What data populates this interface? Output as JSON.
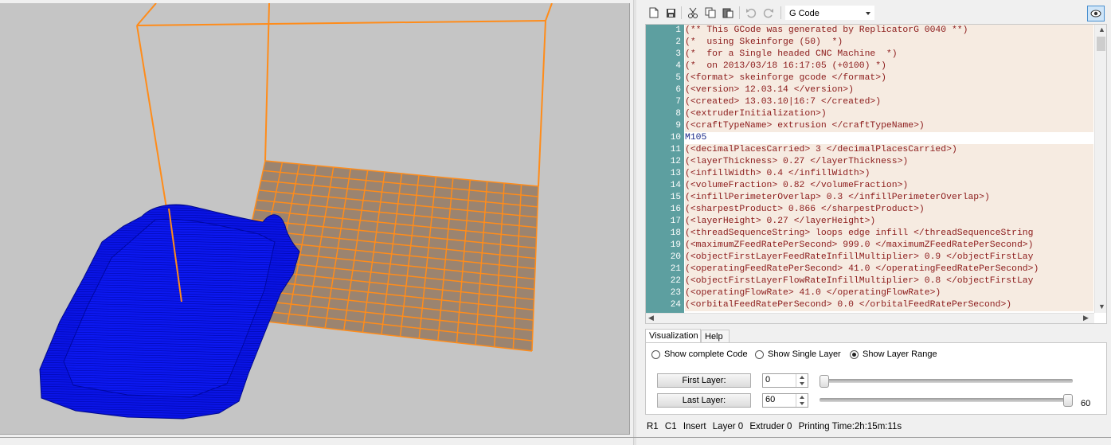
{
  "toolbar": {
    "buttons": [
      "new-file-icon",
      "save-icon",
      "cut-icon",
      "copy-icon",
      "paste-icon",
      "undo-icon",
      "redo-icon"
    ],
    "language": "G Code",
    "view_icon": "eye-icon"
  },
  "editor": {
    "lines": [
      {
        "n": "1",
        "text": "(** This GCode was generated by ReplicatorG 0040 **)",
        "kind": "comment"
      },
      {
        "n": "2",
        "text": "(*  using Skeinforge (50)  *)",
        "kind": "comment"
      },
      {
        "n": "3",
        "text": "(*  for a Single headed CNC Machine  *)",
        "kind": "comment"
      },
      {
        "n": "4",
        "text": "(*  on 2013/03/18 16:17:05 (+0100) *)",
        "kind": "comment"
      },
      {
        "n": "5",
        "text": "(<format> skeinforge gcode </format>)",
        "kind": "comment"
      },
      {
        "n": "6",
        "text": "(<version> 12.03.14 </version>)",
        "kind": "comment"
      },
      {
        "n": "7",
        "text": "(<created> 13.03.10|16:7 </created>)",
        "kind": "comment"
      },
      {
        "n": "8",
        "text": "(<extruderInitialization>)",
        "kind": "comment"
      },
      {
        "n": "9",
        "text": "(<craftTypeName> extrusion </craftTypeName>)",
        "kind": "comment"
      },
      {
        "n": "10",
        "text": "M105",
        "kind": "cmd"
      },
      {
        "n": "11",
        "text": "(<decimalPlacesCarried> 3 </decimalPlacesCarried>)",
        "kind": "comment"
      },
      {
        "n": "12",
        "text": "(<layerThickness> 0.27 </layerThickness>)",
        "kind": "comment"
      },
      {
        "n": "13",
        "text": "(<infillWidth> 0.4 </infillWidth>)",
        "kind": "comment"
      },
      {
        "n": "14",
        "text": "(<volumeFraction> 0.82 </volumeFraction>)",
        "kind": "comment"
      },
      {
        "n": "15",
        "text": "(<infillPerimeterOverlap> 0.3 </infillPerimeterOverlap>)",
        "kind": "comment"
      },
      {
        "n": "16",
        "text": "(<sharpestProduct> 0.866 </sharpestProduct>)",
        "kind": "comment"
      },
      {
        "n": "17",
        "text": "(<layerHeight> 0.27 </layerHeight>)",
        "kind": "comment"
      },
      {
        "n": "18",
        "text": "(<threadSequenceString> loops edge infill </threadSequenceString",
        "kind": "comment"
      },
      {
        "n": "19",
        "text": "(<maximumZFeedRatePerSecond> 999.0 </maximumZFeedRatePerSecond>)",
        "kind": "comment"
      },
      {
        "n": "20",
        "text": "(<objectFirstLayerFeedRateInfillMultiplier> 0.9 </objectFirstLay",
        "kind": "comment"
      },
      {
        "n": "21",
        "text": "(<operatingFeedRatePerSecond> 41.0 </operatingFeedRatePerSecond>)",
        "kind": "comment"
      },
      {
        "n": "22",
        "text": "(<objectFirstLayerFlowRateInfillMultiplier> 0.8 </objectFirstLay",
        "kind": "comment"
      },
      {
        "n": "23",
        "text": "(<operatingFlowRate> 41.0 </operatingFlowRate>)",
        "kind": "comment"
      },
      {
        "n": "24",
        "text": "(<orbitalFeedRatePerSecond> 0.0 </orbitalFeedRatePerSecond>)",
        "kind": "comment"
      }
    ]
  },
  "tabs": {
    "visualization": "Visualization",
    "help": "Help"
  },
  "visualization": {
    "radio_complete": "Show complete Code",
    "radio_single": "Show Single Layer",
    "radio_range": "Show Layer Range",
    "selected": "range",
    "first_layer_label": "First Layer:",
    "first_layer_value": "0",
    "last_layer_label": "Last Layer:",
    "last_layer_value": "60",
    "first_slider_fraction": 0,
    "last_slider_fraction": 1,
    "slider_value_text": "60"
  },
  "status": {
    "row": "R1",
    "col": "C1",
    "mode": "Insert",
    "layer": "Layer 0",
    "extruder": "Extruder 0",
    "printing_time": "Printing Time:2h:15m:11s"
  },
  "colors": {
    "viewport_bg": "#c5c5c5",
    "build_box": "#ff8c1a",
    "model": "#0a14e6",
    "plate": "#9b8470",
    "gutter": "#5d9fa0"
  }
}
